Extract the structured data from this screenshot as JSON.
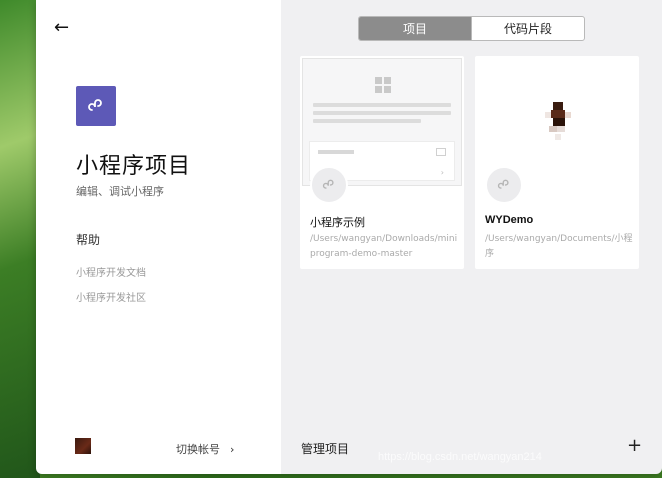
{
  "sidebar": {
    "title": "小程序项目",
    "subtitle": "编辑、调试小程序",
    "help_title": "帮助",
    "help_links": [
      "小程序开发文档",
      "小程序开发社区"
    ],
    "switch_account": "切换帐号"
  },
  "main": {
    "tabs": [
      {
        "label": "项目",
        "active": true
      },
      {
        "label": "代码片段",
        "active": false
      }
    ],
    "projects": [
      {
        "name": "小程序示例",
        "path": "/Users/wangyan/Downloads/miniprogram-demo-master"
      },
      {
        "name": "WYDemo",
        "path": "/Users/wangyan/Documents/小程序"
      }
    ],
    "manage_label": "管理项目",
    "add_symbol": "+"
  },
  "colors": {
    "brand": "#5d59b7",
    "tab_active": "#8c8c8c"
  },
  "icons": [
    "back-arrow-icon",
    "miniprogram-logo-icon",
    "chevron-right-icon",
    "plus-icon"
  ],
  "watermark": "https://blog.csdn.net/wangyan214"
}
